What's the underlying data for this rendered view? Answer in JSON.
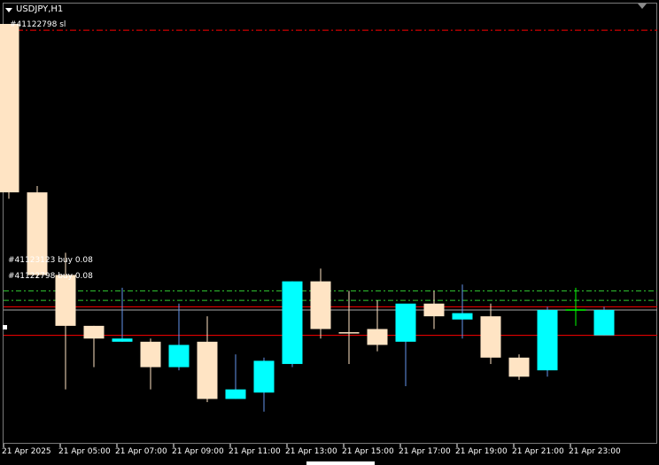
{
  "window": {
    "title": "USDJPY,H1"
  },
  "trade_lines": {
    "sl_label": "#41122798 sl",
    "order1_label": "#41123123 buy 0.08",
    "order2_label": "#41122798 buy 0.08"
  },
  "time_axis": {
    "labels": [
      "21 Apr 2025",
      "21 Apr 05:00",
      "21 Apr 07:00",
      "21 Apr 09:00",
      "21 Apr 11:00",
      "21 Apr 13:00",
      "21 Apr 15:00",
      "21 Apr 17:00",
      "21 Apr 19:00",
      "21 Apr 21:00",
      "21 Apr 23:00"
    ]
  },
  "colors": {
    "background": "#000000",
    "bull_candle": "#00ffff",
    "bear_candle": "#ffe4c4",
    "sl_line": "#ff0000",
    "order_line": "#32cd32",
    "price_line": "#ff0000",
    "doji": "#00ff00"
  },
  "chart_data": {
    "type": "candlestick",
    "symbol": "USDJPY",
    "timeframe": "H1",
    "candles": [
      {
        "index": 0,
        "direction": "bear",
        "open": 141.55,
        "high": 141.55,
        "low": 141.0,
        "close": 141.02
      },
      {
        "index": 1,
        "direction": "bear",
        "open": 141.02,
        "high": 141.04,
        "low": 140.75,
        "close": 140.76
      },
      {
        "index": 2,
        "direction": "bear",
        "open": 140.76,
        "high": 140.83,
        "low": 140.4,
        "close": 140.6
      },
      {
        "index": 3,
        "direction": "bear",
        "open": 140.6,
        "high": 140.6,
        "low": 140.47,
        "close": 140.56
      },
      {
        "index": 4,
        "direction": "bull",
        "open": 140.55,
        "high": 140.72,
        "low": 140.55,
        "close": 140.56
      },
      {
        "index": 5,
        "direction": "bear",
        "open": 140.55,
        "high": 140.56,
        "low": 140.4,
        "close": 140.47
      },
      {
        "index": 6,
        "direction": "bull",
        "open": 140.47,
        "high": 140.67,
        "low": 140.46,
        "close": 140.54
      },
      {
        "index": 7,
        "direction": "bear",
        "open": 140.55,
        "high": 140.63,
        "low": 140.36,
        "close": 140.37
      },
      {
        "index": 8,
        "direction": "bull",
        "open": 140.37,
        "high": 140.51,
        "low": 140.37,
        "close": 140.4
      },
      {
        "index": 9,
        "direction": "bull",
        "open": 140.39,
        "high": 140.5,
        "low": 140.33,
        "close": 140.49
      },
      {
        "index": 10,
        "direction": "bull",
        "open": 140.48,
        "high": 140.74,
        "low": 140.47,
        "close": 140.74
      },
      {
        "index": 11,
        "direction": "bear",
        "open": 140.74,
        "high": 140.78,
        "low": 140.56,
        "close": 140.59
      },
      {
        "index": 12,
        "direction": "bear",
        "open": 140.58,
        "high": 140.71,
        "low": 140.48,
        "close": 140.58
      },
      {
        "index": 13,
        "direction": "bear",
        "open": 140.59,
        "high": 140.68,
        "low": 140.52,
        "close": 140.54
      },
      {
        "index": 14,
        "direction": "bull",
        "open": 140.55,
        "high": 140.66,
        "low": 140.41,
        "close": 140.67
      },
      {
        "index": 15,
        "direction": "bear",
        "open": 140.67,
        "high": 140.71,
        "low": 140.59,
        "close": 140.63
      },
      {
        "index": 16,
        "direction": "bull",
        "open": 140.62,
        "high": 140.73,
        "low": 140.56,
        "close": 140.64
      },
      {
        "index": 17,
        "direction": "bear",
        "open": 140.63,
        "high": 140.67,
        "low": 140.48,
        "close": 140.5
      },
      {
        "index": 18,
        "direction": "bear",
        "open": 140.5,
        "high": 140.51,
        "low": 140.43,
        "close": 140.44
      },
      {
        "index": 19,
        "direction": "bull",
        "open": 140.46,
        "high": 140.66,
        "low": 140.44,
        "close": 140.65
      },
      {
        "index": 20,
        "direction": "doji",
        "open": 140.65,
        "high": 140.72,
        "low": 140.6,
        "close": 140.65
      },
      {
        "index": 21,
        "direction": "bull",
        "open": 140.57,
        "high": 140.66,
        "low": 140.57,
        "close": 140.65
      }
    ],
    "sl_level": 141.53,
    "order_levels": [
      140.71,
      140.68
    ],
    "price_lines": [
      140.66,
      140.65,
      140.57
    ],
    "ylim": [
      140.36,
      141.55
    ]
  }
}
